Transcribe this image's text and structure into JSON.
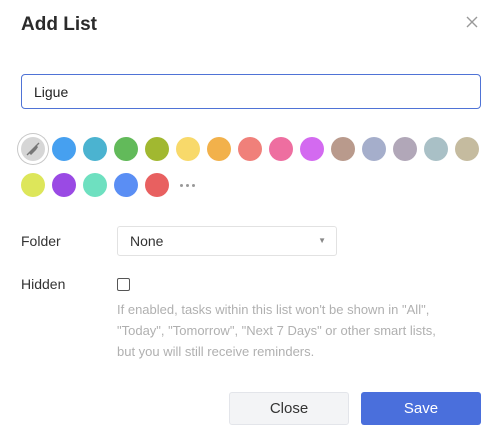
{
  "dialog": {
    "title": "Add List",
    "close_icon": "close-icon"
  },
  "name_field": {
    "value": "Ligue"
  },
  "colors": {
    "none_icon": "no-color-icon",
    "row1": [
      "#46a0f0",
      "#4bb3d0",
      "#62ba5a",
      "#a1b830",
      "#f8d96a",
      "#f2b14b",
      "#f0807a",
      "#ee6ea0",
      "#d36af0",
      "#b99a8c",
      "#a5aecb",
      "#b1a7b8",
      "#a9c0c6",
      "#c5bb9f"
    ],
    "row2": [
      "#dde65a",
      "#9a4ae4",
      "#6ee0c0",
      "#5a8ef4",
      "#e86060"
    ],
    "more_icon": "more-icon"
  },
  "folder": {
    "label": "Folder",
    "selected": "None"
  },
  "hidden": {
    "label": "Hidden",
    "checked": false,
    "help_line1": "If enabled, tasks within this list won't be shown in \"All\",",
    "help_line2": "\"Today\", \"Tomorrow\", \"Next 7 Days\" or other smart lists,",
    "help_line3": "but you will still receive reminders."
  },
  "actions": {
    "close_label": "Close",
    "save_label": "Save"
  }
}
